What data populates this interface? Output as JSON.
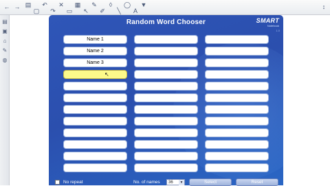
{
  "toolbar": {
    "icons": [
      {
        "name": "view-screens-icon",
        "glyph": "▤"
      },
      {
        "name": "new-page-icon",
        "glyph": "▢"
      },
      {
        "name": "undo-icon",
        "glyph": "↶"
      },
      {
        "name": "redo-icon",
        "glyph": "↷"
      },
      {
        "name": "delete-icon",
        "glyph": "✕"
      },
      {
        "name": "screen-shade-icon",
        "glyph": "▭"
      },
      {
        "name": "table-icon",
        "glyph": "▦"
      },
      {
        "name": "select-icon",
        "glyph": "↖"
      },
      {
        "name": "pen-icon",
        "glyph": "✎"
      },
      {
        "name": "highlighter-icon",
        "glyph": "✐"
      },
      {
        "name": "eraser-icon",
        "glyph": "◊"
      },
      {
        "name": "line-icon",
        "glyph": "╲"
      },
      {
        "name": "shapes-icon",
        "glyph": "◯"
      },
      {
        "name": "text-icon",
        "glyph": "A"
      },
      {
        "name": "fill-icon",
        "glyph": "▼"
      }
    ],
    "back_icon": "←",
    "forward_icon": "→",
    "toggle_icon": "↕"
  },
  "sidebar": {
    "icons": [
      {
        "name": "page-sorter-icon",
        "glyph": "▤"
      },
      {
        "name": "gallery-icon",
        "glyph": "▣"
      },
      {
        "name": "attachments-icon",
        "glyph": "⌂"
      },
      {
        "name": "properties-icon",
        "glyph": "✎"
      },
      {
        "name": "addons-icon",
        "glyph": "◍"
      }
    ]
  },
  "app": {
    "title": "Random Word Chooser",
    "logo": "SMART",
    "logo_sub": "Notebook",
    "version": "1.0"
  },
  "grid": {
    "columns": [
      [
        "Name 1",
        "Name 2",
        "Name 3",
        "",
        "",
        "",
        "",
        "",
        "",
        "",
        "",
        ""
      ],
      [
        "",
        "",
        "",
        "",
        "",
        "",
        "",
        "",
        "",
        "",
        "",
        ""
      ],
      [
        "",
        "",
        "",
        "",
        "",
        "",
        "",
        "",
        "",
        "",
        "",
        ""
      ]
    ],
    "selected": {
      "column": 0,
      "row": 3
    }
  },
  "footer": {
    "no_repeat_label": "No repeat",
    "num_names_label": "No. of names",
    "num_names_value": "36",
    "select_label": "Select",
    "reset_label": "Reset"
  },
  "colors": {
    "panel": "#2f56b8",
    "selected_cell": "#fdfa8a"
  }
}
